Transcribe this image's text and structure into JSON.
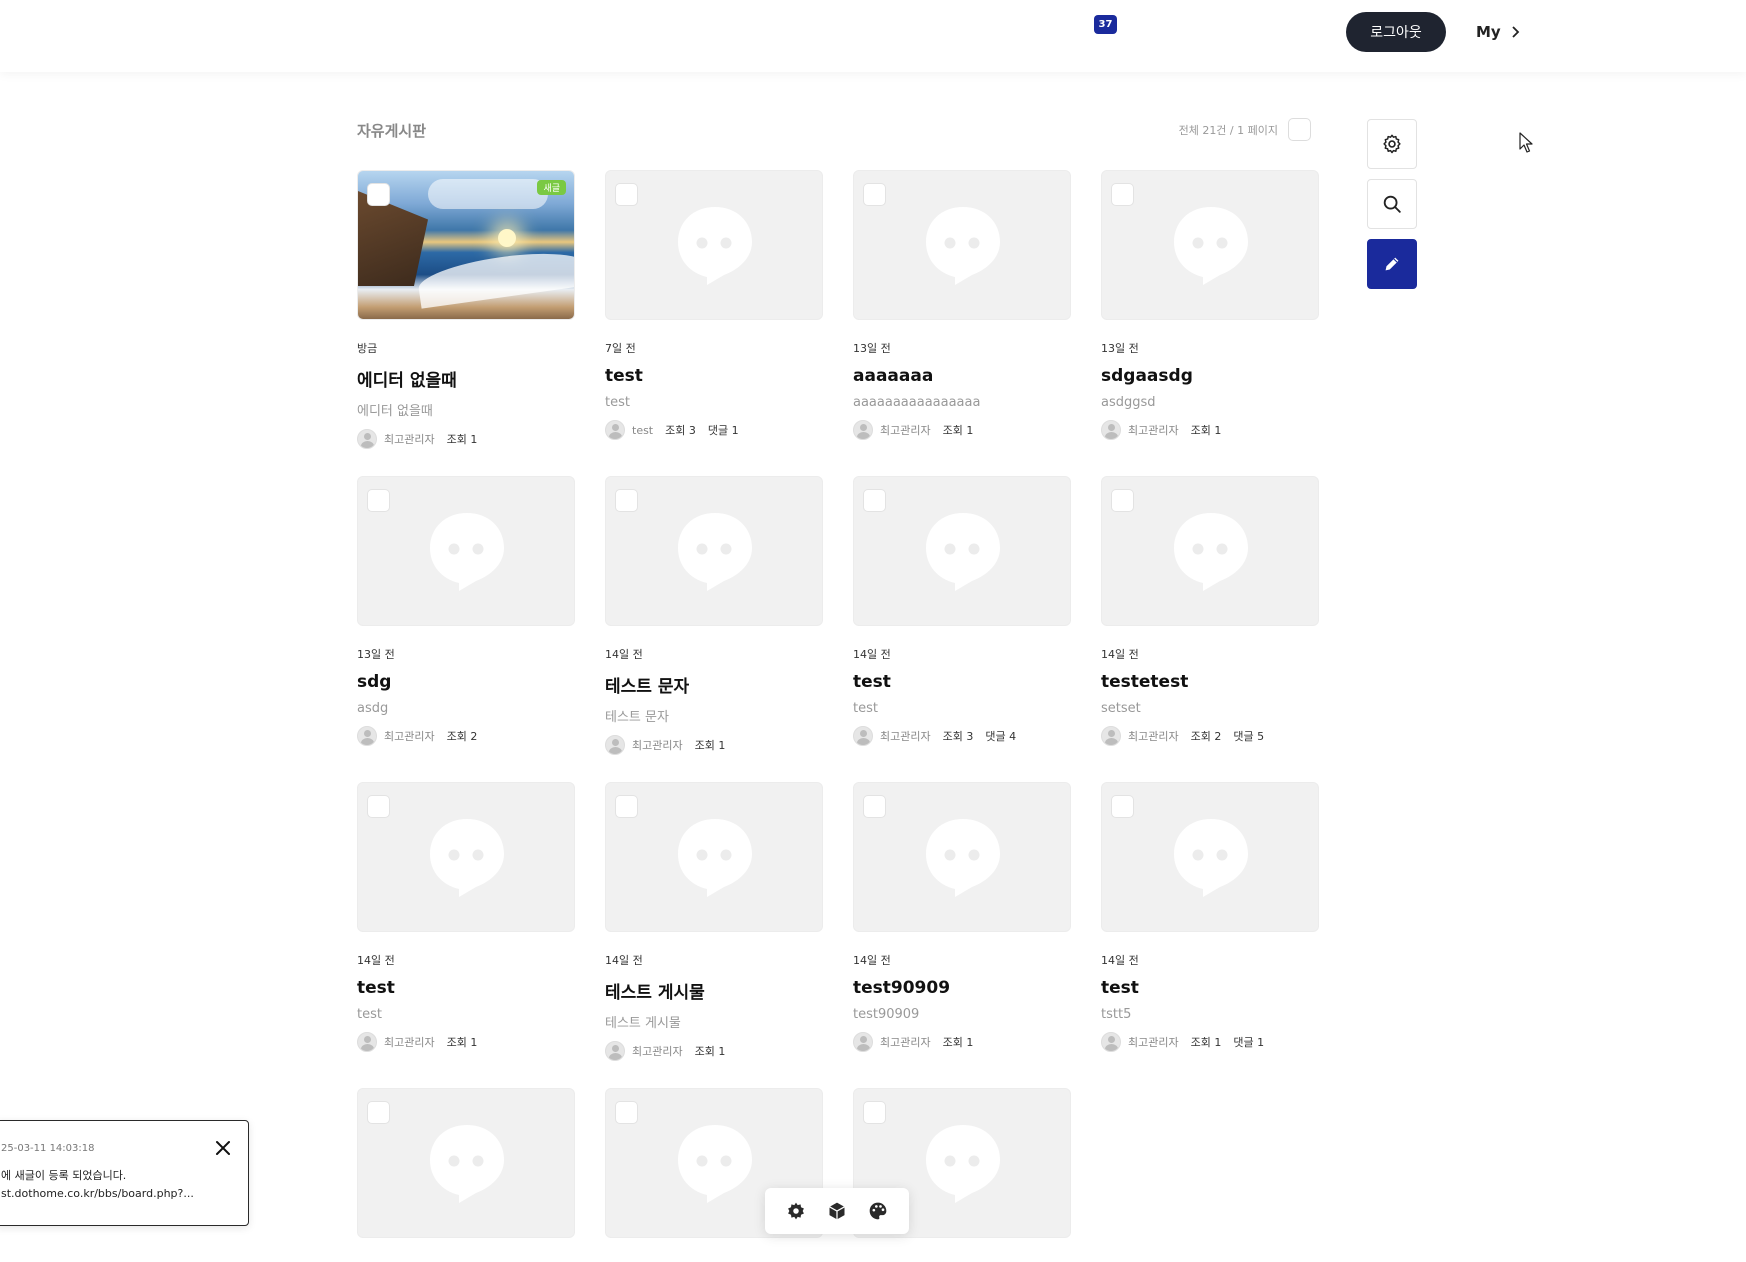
{
  "header": {
    "notification_count": "37",
    "logout_label": "로그아웃",
    "my_label": "My"
  },
  "board": {
    "title": "자유게시판",
    "count_text": "전체 21건 / 1 페이지"
  },
  "side_buttons": [
    "gear-icon",
    "search-icon",
    "pencil-icon"
  ],
  "posts": [
    {
      "date": "방금",
      "title": "에디터 없을때",
      "excerpt": "에디터 없을때",
      "author": "최고관리자",
      "views": "조회 1",
      "comments": "",
      "has_image": true,
      "new_label": "새글"
    },
    {
      "date": "7일 전",
      "title": "test",
      "excerpt": "test",
      "author": "test",
      "views": "조회 3",
      "comments": "댓글 1"
    },
    {
      "date": "13일 전",
      "title": "aaaaaaa",
      "excerpt": "aaaaaaaaaaaaaaaa",
      "author": "최고관리자",
      "views": "조회 1",
      "comments": ""
    },
    {
      "date": "13일 전",
      "title": "sdgaasdg",
      "excerpt": "asdggsd",
      "author": "최고관리자",
      "views": "조회 1",
      "comments": ""
    },
    {
      "date": "13일 전",
      "title": "sdg",
      "excerpt": "asdg",
      "author": "최고관리자",
      "views": "조회 2",
      "comments": ""
    },
    {
      "date": "14일 전",
      "title": "테스트 문자",
      "excerpt": "테스트 문자",
      "author": "최고관리자",
      "views": "조회 1",
      "comments": ""
    },
    {
      "date": "14일 전",
      "title": "test",
      "excerpt": "test",
      "author": "최고관리자",
      "views": "조회 3",
      "comments": "댓글 4"
    },
    {
      "date": "14일 전",
      "title": "testetest",
      "excerpt": "setset",
      "author": "최고관리자",
      "views": "조회 2",
      "comments": "댓글 5"
    },
    {
      "date": "14일 전",
      "title": "test",
      "excerpt": "test",
      "author": "최고관리자",
      "views": "조회 1",
      "comments": ""
    },
    {
      "date": "14일 전",
      "title": "테스트 게시물",
      "excerpt": "테스트 게시물",
      "author": "최고관리자",
      "views": "조회 1",
      "comments": ""
    },
    {
      "date": "14일 전",
      "title": "test90909",
      "excerpt": "test90909",
      "author": "최고관리자",
      "views": "조회 1",
      "comments": ""
    },
    {
      "date": "14일 전",
      "title": "test",
      "excerpt": "tstt5",
      "author": "최고관리자",
      "views": "조회 1",
      "comments": "댓글 1"
    },
    {
      "date": "",
      "title": "",
      "excerpt": "",
      "author": "",
      "views": "",
      "comments": ""
    },
    {
      "date": "",
      "title": "",
      "excerpt": "",
      "author": "",
      "views": "",
      "comments": ""
    },
    {
      "date": "",
      "title": "",
      "excerpt": "",
      "author": "",
      "views": "",
      "comments": ""
    }
  ],
  "toast": {
    "time": "25-03-11 14:03:18",
    "message": "에 새글이 등록 되었습니다.",
    "link": "st.dothome.co.kr/bbs/board.php?..."
  },
  "toolbar": [
    "settings-icon",
    "cube-icon",
    "palette-icon"
  ],
  "colors": {
    "accent": "#1a2a9c",
    "dark_button": "#1f2430",
    "new_badge": "#7ac943"
  }
}
